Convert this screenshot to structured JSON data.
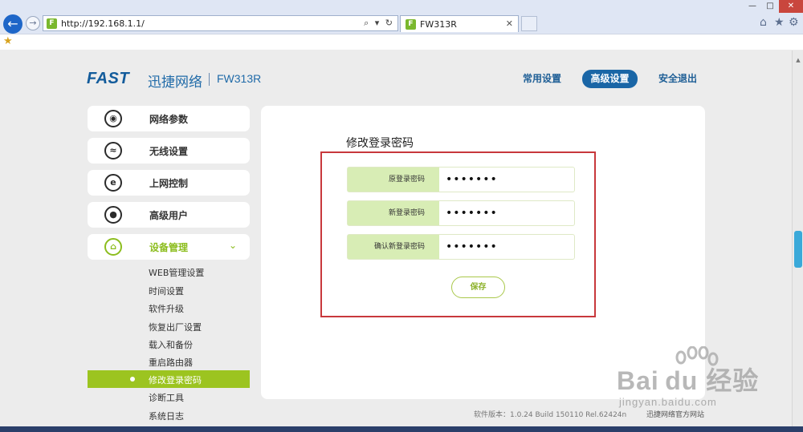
{
  "browser": {
    "url": "http://192.168.1.1/",
    "address_tools": "⌕ ▾ ↻",
    "tab_title": "FW313R",
    "favicon_letter": "F"
  },
  "header": {
    "brand": "FAST",
    "brand_cn": "迅捷网络",
    "model": "FW313R",
    "nav": {
      "common": "常用设置",
      "advanced": "高级设置",
      "logout": "安全退出"
    }
  },
  "sidebar": {
    "menus": [
      {
        "label": "网络参数",
        "icon": "globe-icon"
      },
      {
        "label": "无线设置",
        "icon": "wifi-icon"
      },
      {
        "label": "上网控制",
        "icon": "internet-e-icon"
      },
      {
        "label": "高级用户",
        "icon": "user-icon"
      },
      {
        "label": "设备管理",
        "icon": "router-icon",
        "active": true
      }
    ],
    "sub_items": [
      "WEB管理设置",
      "时间设置",
      "软件升级",
      "恢复出厂设置",
      "载入和备份",
      "重启路由器",
      "修改登录密码",
      "诊断工具",
      "系统日志"
    ],
    "active_sub_index": 6
  },
  "main": {
    "title": "修改登录密码",
    "fields": [
      {
        "label": "原登录密码",
        "value": "1234567"
      },
      {
        "label": "新登录密码",
        "value": "1234567"
      },
      {
        "label": "确认新登录密码",
        "value": "1234567"
      }
    ],
    "save_label": "保存"
  },
  "footer": {
    "version": "软件版本：1.0.24 Build 150110 Rel.62424n",
    "site_link": "迅捷网络官方网站"
  },
  "watermark": {
    "text": "Bai du 经验",
    "sub": "jingyan.baidu.com"
  },
  "colors": {
    "brand_blue": "#1a66a6",
    "accent_green": "#9cc420",
    "highlight_red": "#c8383c"
  }
}
